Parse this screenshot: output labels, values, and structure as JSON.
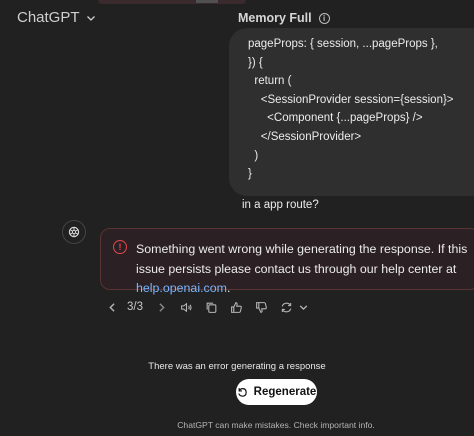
{
  "header": {
    "model_label": "ChatGPT",
    "memory_label": "Memory Full"
  },
  "user_message": {
    "code_lines": [
      "pageProps: { session, ...pageProps },",
      "}) {",
      "  return (",
      "    <SessionProvider session={session}>",
      "      <Component {...pageProps} />",
      "    </SessionProvider>",
      "  )",
      "}"
    ],
    "question": "in a app route?"
  },
  "error": {
    "message_prefix": "Something went wrong while generating the response. If this issue persists please contact us through our help center at",
    "link_text": "help.openai.com",
    "message_suffix": "."
  },
  "pagination": {
    "current": "3/3"
  },
  "footer": {
    "generation_error": "There was an error generating a response",
    "regenerate_label": "Regenerate",
    "disclaimer": "ChatGPT can make mistakes. Check important info."
  },
  "colors": {
    "background": "#212121",
    "bubble": "#2f2f2f",
    "error_red": "#e5484d",
    "link_blue": "#7ab7ff"
  },
  "icons": [
    "chevron-down-icon",
    "info-icon",
    "openai-logo-icon",
    "alert-circle-icon",
    "chevron-left-icon",
    "chevron-right-icon",
    "speaker-icon",
    "copy-icon",
    "thumbs-up-icon",
    "thumbs-down-icon",
    "refresh-icon",
    "regenerate-icon"
  ]
}
